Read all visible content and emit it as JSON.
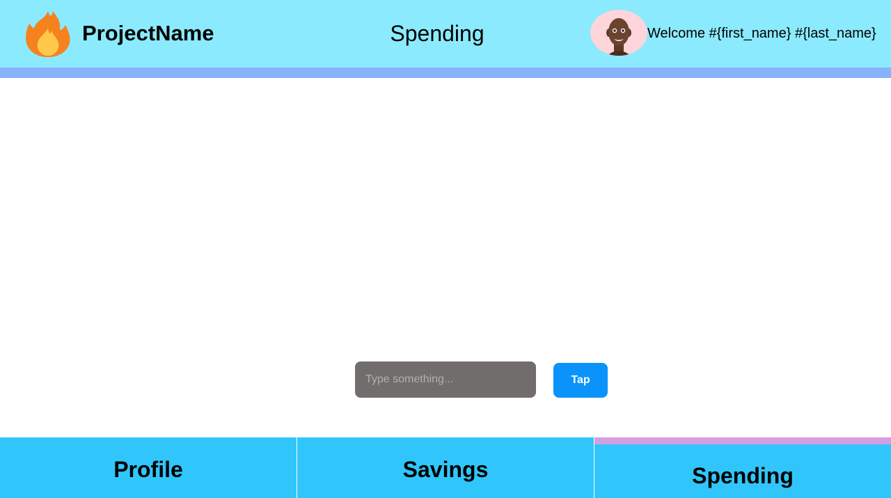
{
  "header": {
    "logo_icon": "fire-icon",
    "brand": "ProjectName",
    "title": "Spending",
    "avatar_icon": "person-avatar-icon",
    "welcome": "Welcome #{first_name} #{last_name}"
  },
  "main": {
    "input_value": "",
    "input_placeholder": "Type something...",
    "button_label": "Tap"
  },
  "nav": {
    "tabs": [
      {
        "label": "Profile",
        "active": false
      },
      {
        "label": "Savings",
        "active": false
      },
      {
        "label": "Spending",
        "active": true
      }
    ]
  },
  "colors": {
    "header_bg": "#8beafd",
    "header_stripe": "#87b3fb",
    "nav_bg": "#30c6fc",
    "active_indicator": "#d59de2",
    "button_bg": "#0a93fb",
    "input_bg": "#716d6c",
    "avatar_bg": "#fdd5da"
  }
}
